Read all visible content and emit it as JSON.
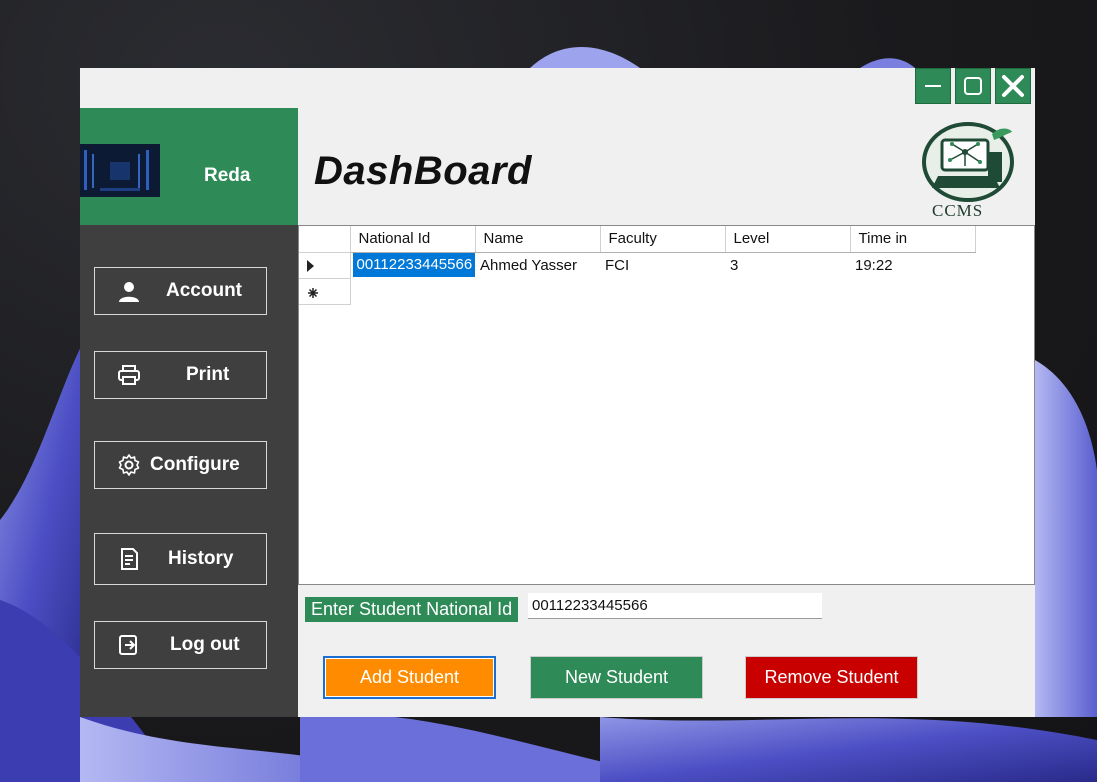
{
  "window": {
    "controls": {
      "minimize_icon": "minimize-icon",
      "maximize_icon": "maximize-icon",
      "close_icon": "close-icon"
    }
  },
  "sidebar": {
    "username": "Reda",
    "items": [
      {
        "label": "Account",
        "icon": "user-icon"
      },
      {
        "label": "Print",
        "icon": "printer-icon"
      },
      {
        "label": "Configure",
        "icon": "gear-icon"
      },
      {
        "label": "History",
        "icon": "history-icon"
      },
      {
        "label": "Log out",
        "icon": "logout-icon"
      }
    ]
  },
  "header": {
    "title": "DashBoard",
    "logo_text": "CCMS"
  },
  "grid": {
    "columns": [
      "National Id",
      "Name",
      "Faculty",
      "Level",
      "Time in"
    ],
    "rows": [
      [
        "00112233445566",
        "Ahmed Yasser",
        "FCI",
        "3",
        "19:22"
      ]
    ]
  },
  "form": {
    "label": "Enter Student National Id",
    "value": "00112233445566"
  },
  "actions": {
    "add": "Add Student",
    "new": "New Student",
    "remove": "Remove Student"
  },
  "colors": {
    "accent_green": "#2e8b57",
    "sidebar_bg": "#3f3f3f",
    "add_orange": "#ff8c00",
    "remove_red": "#c80000",
    "selection_blue": "#0078d7"
  }
}
